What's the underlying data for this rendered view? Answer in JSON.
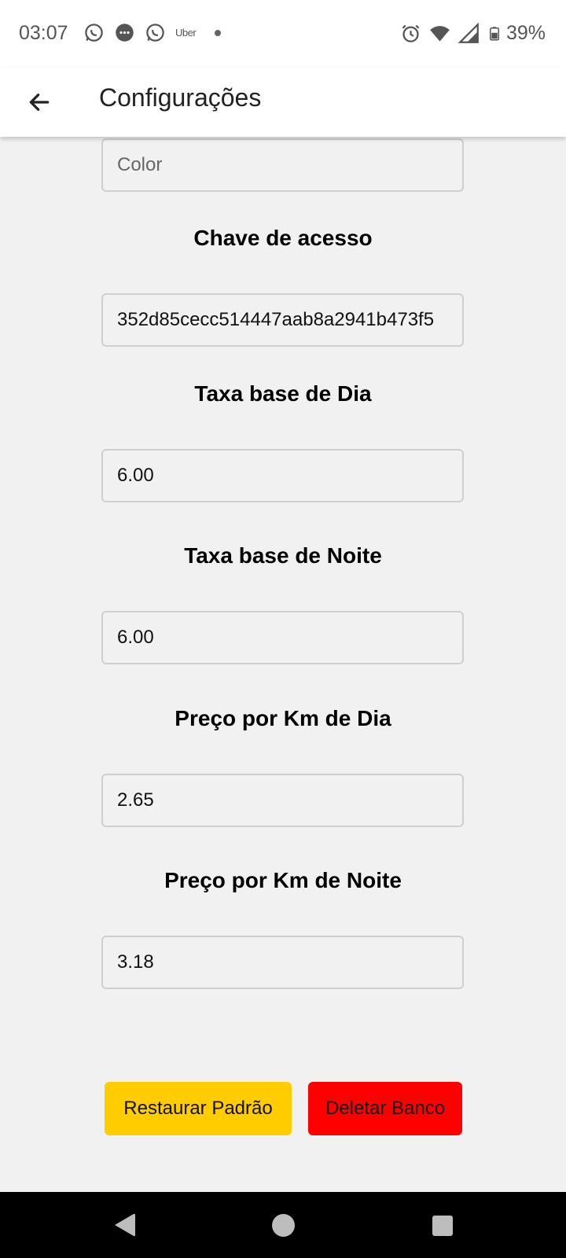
{
  "status_bar": {
    "time": "03:07",
    "left_icons": [
      "whatsapp-icon",
      "messages-icon",
      "whatsapp-icon",
      "uber-icon",
      "dot-icon"
    ],
    "uber_label": "Uber",
    "right_icons": [
      "alarm-icon",
      "wifi-icon",
      "signal-icon",
      "battery-icon"
    ],
    "battery": "39%"
  },
  "app_bar": {
    "title": "Configurações",
    "back_icon": "arrow-left-icon"
  },
  "form": {
    "color_placeholder": "Color",
    "access_key_label": "Chave de acesso",
    "access_key_value": "352d85cecc514447aab8a2941b473f5",
    "day_base_label": "Taxa base de Dia",
    "day_base_value": "6.00",
    "night_base_label": "Taxa base de Noite",
    "night_base_value": "6.00",
    "day_km_label": "Preço por Km de Dia",
    "day_km_value": "2.65",
    "night_km_label": "Preço por Km de Noite",
    "night_km_value": "3.18"
  },
  "buttons": {
    "restore_label": "Restaurar Padrão",
    "restore_color": "#ffcc00",
    "delete_label": "Deletar Banco",
    "delete_color": "#ff0000"
  },
  "nav_bar": {
    "icons": [
      "nav-back-icon",
      "nav-home-icon",
      "nav-recents-icon"
    ]
  }
}
